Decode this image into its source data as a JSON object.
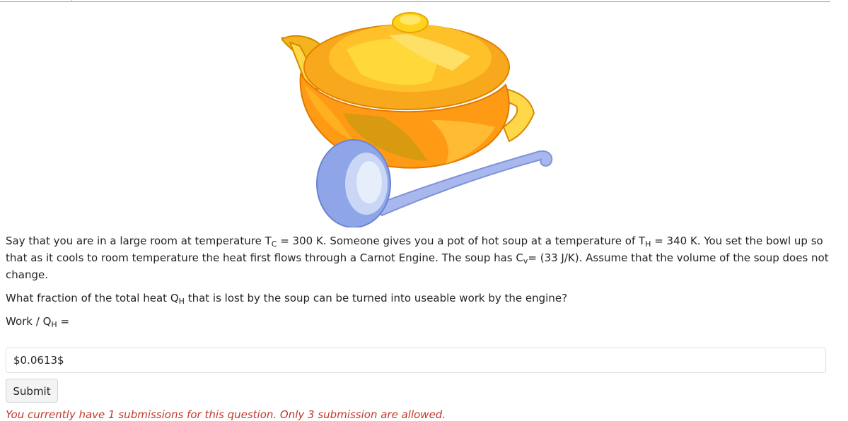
{
  "question": {
    "intro": {
      "t1": "Say that you are in a large room at temperature T",
      "s1": "C",
      "t2": " = 300 K. Someone gives you a pot of hot soup at a temperature of T",
      "s2": "H",
      "t3": " = 340 K. You set the bowl up so that as it cools to room temperature the heat first flows through a Carnot Engine. The soup has C",
      "s3": "v",
      "t4": "= (33 J/K). Assume that the volume of the soup does not change."
    },
    "prompt": {
      "t1": "What fraction of the total heat Q",
      "s1": "H",
      "t2": " that is lost by the soup can be turned into useable work by the engine?"
    },
    "label": {
      "t1": "Work / Q",
      "s1": "H",
      "t2": " ="
    }
  },
  "answer_value": "$0.0613$",
  "submit_label": "Submit",
  "submission_note": "You currently have 1 submissions for this question. Only 3 submission are allowed.",
  "colors": {
    "pot_orange": "#ff9a14",
    "pot_yellow": "#ffd21e",
    "ladle_blue": "#8ea6e8",
    "note_red": "#c0392b"
  }
}
